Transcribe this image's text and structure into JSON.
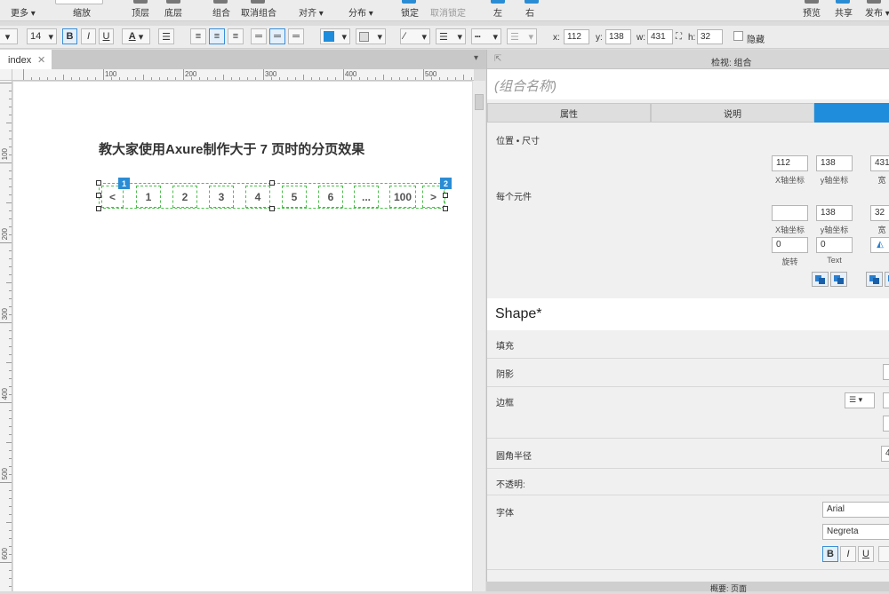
{
  "toolbar_top": {
    "more": "更多",
    "zoom": "缩放",
    "top_layer": "顶层",
    "bottom_layer": "底层",
    "group": "组合",
    "ungroup": "取消组合",
    "align": "对齐",
    "distribute": "分布",
    "lock": "锁定",
    "unlock": "取消锁定",
    "left": "左",
    "right": "右",
    "preview": "预览",
    "share": "共享",
    "publish": "发布"
  },
  "toolbar_style": {
    "font_size": "14",
    "bold": "B",
    "italic": "I",
    "underline": "U",
    "font_color": "A",
    "x_label": "x:",
    "x_value": "112",
    "y_label": "y:",
    "y_value": "138",
    "w_label": "w:",
    "w_value": "431",
    "h_label": "h:",
    "h_value": "32",
    "hide_label": "隐藏",
    "fill_color": "#1f8ddb"
  },
  "tab": {
    "label": "index",
    "close": "✕"
  },
  "ruler": {
    "h": [
      "100",
      "200",
      "300",
      "400",
      "500"
    ],
    "v": [
      "100",
      "200",
      "300",
      "400",
      "500",
      "600"
    ]
  },
  "canvas": {
    "title": "教大家使用Axure制作大于 7 页时的分页效果",
    "pages": [
      "<",
      "1",
      "2",
      "3",
      "4",
      "5",
      "6",
      "...",
      "100",
      ">"
    ],
    "badge1": "1",
    "badge2": "2"
  },
  "inspector": {
    "header": "检视: 组合",
    "group_name": "(组合名称)",
    "tabs": [
      "属性",
      "说明",
      ""
    ],
    "position_size": "位置 • 尺寸",
    "x1": "112",
    "y1": "138",
    "w1": "431",
    "x_caption": "X轴坐标",
    "y_caption": "y轴坐标",
    "w_caption": "宽",
    "each_element": "每个元件",
    "x2": "",
    "y2": "138",
    "w2": "32",
    "rotate": "0",
    "text_rot": "0",
    "rotate_caption": "旋转",
    "text_caption": "Text",
    "shape_title": "Shape*",
    "fill": "填充",
    "shadow": "阴影",
    "border": "边框",
    "corner_radius": "圆角半径",
    "corner_value": "4",
    "opacity": "不透明:",
    "font": "字体",
    "font_name": "Arial",
    "font_style": "Negreta",
    "bold": "B",
    "italic": "I",
    "underline": "U"
  },
  "bottom_bar": "概要: 页面"
}
